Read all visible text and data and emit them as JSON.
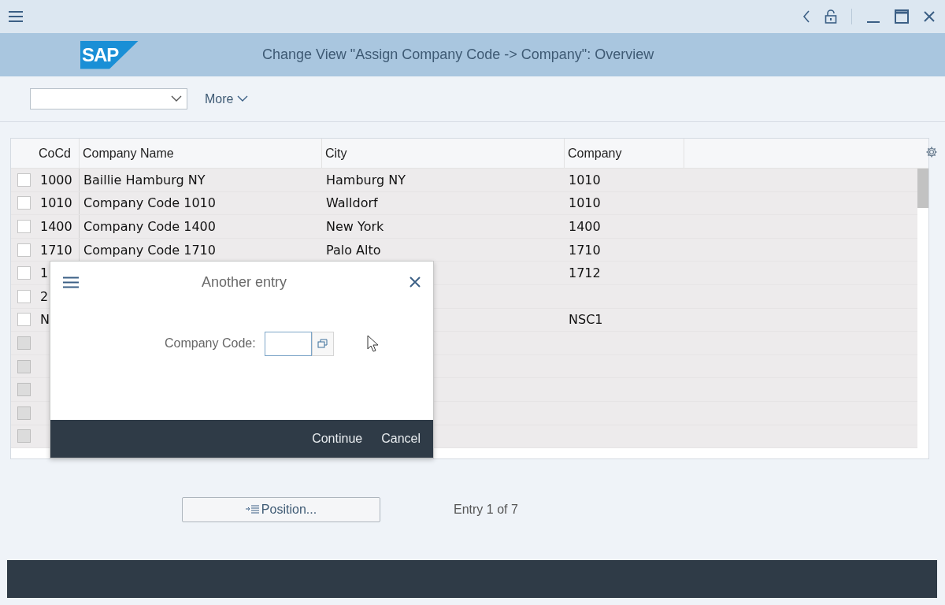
{
  "window": {
    "title": "Change View \"Assign Company Code -> Company\": Overview"
  },
  "logo": "SAP",
  "toolbar": {
    "more": "More"
  },
  "table": {
    "columns": [
      "CoCd",
      "Company Name",
      "City",
      "Company"
    ],
    "rows": [
      {
        "cocd": "1000",
        "name": "Baillie Hamburg NY",
        "city": "Hamburg NY",
        "company": "1010",
        "disabled": false
      },
      {
        "cocd": "1010",
        "name": "Company Code 1010",
        "city": "Walldorf",
        "company": "1010",
        "disabled": false
      },
      {
        "cocd": "1400",
        "name": "Company Code 1400",
        "city": "New York",
        "company": "1400",
        "disabled": false
      },
      {
        "cocd": "1710",
        "name": "Company Code 1710",
        "city": "Palo Alto",
        "company": "1710",
        "disabled": false
      },
      {
        "cocd": "1",
        "company": "1712",
        "disabled": false
      },
      {
        "cocd": "2",
        "disabled": false
      },
      {
        "cocd": "N",
        "company": "NSC1",
        "disabled": false
      },
      {
        "disabled": true
      },
      {
        "disabled": true
      },
      {
        "disabled": true
      },
      {
        "disabled": true
      },
      {
        "disabled": true
      }
    ]
  },
  "dialog": {
    "title": "Another entry",
    "field_label": "Company Code:",
    "buttons": [
      "Continue",
      "Cancel"
    ]
  },
  "position_button": "Position...",
  "entry_count": "Entry 1 of 7"
}
